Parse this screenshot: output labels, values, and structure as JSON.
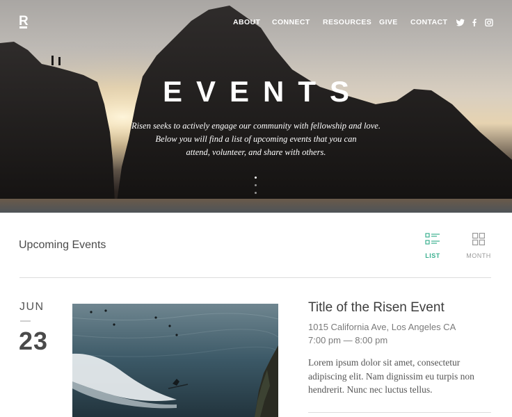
{
  "header": {
    "logo": "R",
    "nav": [
      {
        "label": "ABOUT"
      },
      {
        "label": "CONNECT"
      },
      {
        "label": "RESOURCES"
      },
      {
        "label": "GIVE"
      },
      {
        "label": "CONTACT"
      }
    ],
    "social": [
      {
        "icon": "twitter-icon"
      },
      {
        "icon": "facebook-icon"
      },
      {
        "icon": "instagram-icon"
      }
    ]
  },
  "hero": {
    "title": "EVENTS",
    "subtitle_lines": [
      "Risen seeks to actively engage our community with fellowship and love.",
      "Below you will find a list of upcoming events that you can",
      "attend, volunteer, and share with others."
    ],
    "slides": {
      "count": 3,
      "active": 1
    }
  },
  "section": {
    "title": "Upcoming Events",
    "views": [
      {
        "label": "LIST",
        "icon": "list-view-icon",
        "active": true
      },
      {
        "label": "MONTH",
        "icon": "grid-view-icon",
        "active": false
      }
    ]
  },
  "events": [
    {
      "month": "JUN",
      "day": "23",
      "title": "Title of the Risen Event",
      "address": "1015 California Ave, Los Angeles CA",
      "time": "7:00 pm — 8:00 pm",
      "description_lines": [
        "Lorem ipsum dolor sit amet, consectetur",
        "adipiscing elit. Nam dignissim eu turpis non",
        "hendrerit. Nunc nec luctus tellus."
      ]
    }
  ],
  "colors": {
    "accent": "#3bb08f",
    "text": "#4a4a4a",
    "muted": "#9a9a9a"
  }
}
